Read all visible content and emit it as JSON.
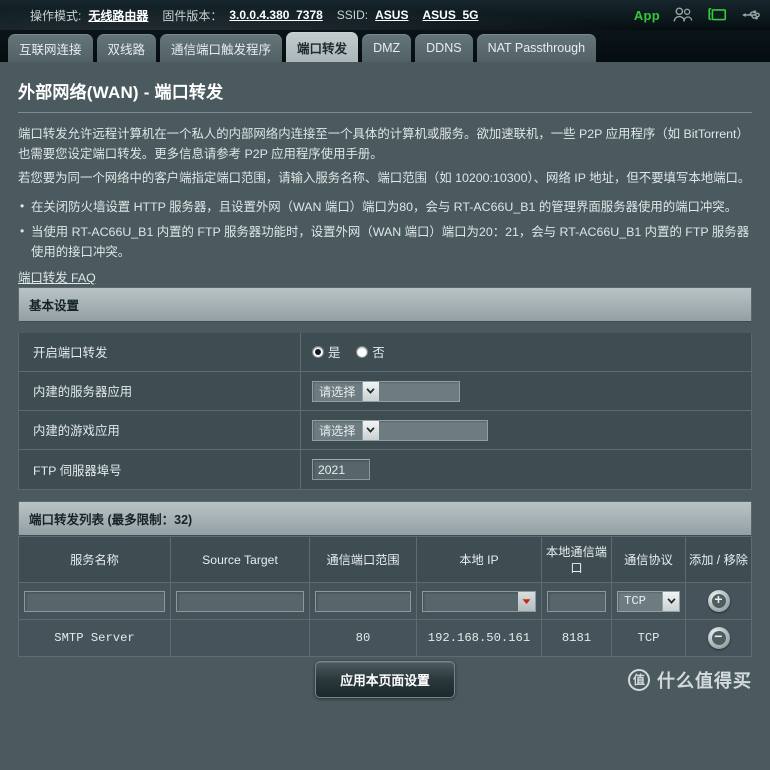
{
  "topbar": {
    "mode_label": "操作模式:",
    "mode_value": "无线路由器",
    "firmware_label": "固件版本：",
    "firmware_value": "3.0.0.4.380_7378",
    "ssid_label": "SSID:",
    "ssid_1": "ASUS",
    "ssid_2": "ASUS_5G",
    "app_label": "App",
    "accent_green": "#35c83a"
  },
  "tabs": [
    {
      "label": "互联网连接",
      "active": false
    },
    {
      "label": "双线路",
      "active": false
    },
    {
      "label": "通信端口触发程序",
      "active": false
    },
    {
      "label": "端口转发",
      "active": true
    },
    {
      "label": "DMZ",
      "active": false
    },
    {
      "label": "DDNS",
      "active": false
    },
    {
      "label": "NAT Passthrough",
      "active": false
    }
  ],
  "page": {
    "title": "外部网络(WAN) - 端口转发",
    "desc_1": "端口转发允许远程计算机在一个私人的内部网络内连接至一个具体的计算机或服务。欲加速联机，一些 P2P 应用程序（如 BitTorrent）也需要您设定端口转发。更多信息请参考 P2P 应用程序使用手册。",
    "desc_2": "若您要为同一个网络中的客户端指定端口范围，请输入服务名称、端口范围（如 10200:10300）、网络 IP 地址，但不要填写本地端口。",
    "note_1": "在关闭防火墙设置 HTTP 服务器，且设置外网（WAN 端口）端口为80，会与 RT-AC66U_B1 的管理界面服务器使用的端口冲突。",
    "note_2": "当使用 RT-AC66U_B1 内置的 FTP 服务器功能时，设置外网（WAN 端口）端口为20：21，会与 RT-AC66U_B1 内置的 FTP 服务器使用的接口冲突。",
    "faq_link": "端口转发 FAQ"
  },
  "basic_settings": {
    "header": "基本设置",
    "enable_label": "开启端口转发",
    "enable_yes": "是",
    "enable_no": "否",
    "enable_selected": "是",
    "server_app_label": "内建的服务器应用",
    "server_app_value": "请选择",
    "game_app_label": "内建的游戏应用",
    "game_app_value": "请选择",
    "ftp_port_label": "FTP 伺服器埠号",
    "ftp_port_value": "2021"
  },
  "forward_list": {
    "header": "端口转发列表 (最多限制：32)",
    "columns": [
      "服务名称",
      "Source Target",
      "通信端口范围",
      "本地 IP",
      "本地通信端口",
      "通信协议",
      "添加 / 移除"
    ],
    "input_row": {
      "service_name": "",
      "source_target": "",
      "port_range": "",
      "local_ip": "",
      "local_port": "",
      "protocol": "TCP",
      "action": "add"
    },
    "rows": [
      {
        "service_name": "SMTP Server",
        "source_target": "",
        "port_range": "80",
        "local_ip": "192.168.50.161",
        "local_port": "8181",
        "protocol": "TCP",
        "action": "remove"
      }
    ]
  },
  "footer": {
    "apply_label": "应用本页面设置",
    "watermark_badge": "值",
    "watermark_text": "什么值得买"
  }
}
